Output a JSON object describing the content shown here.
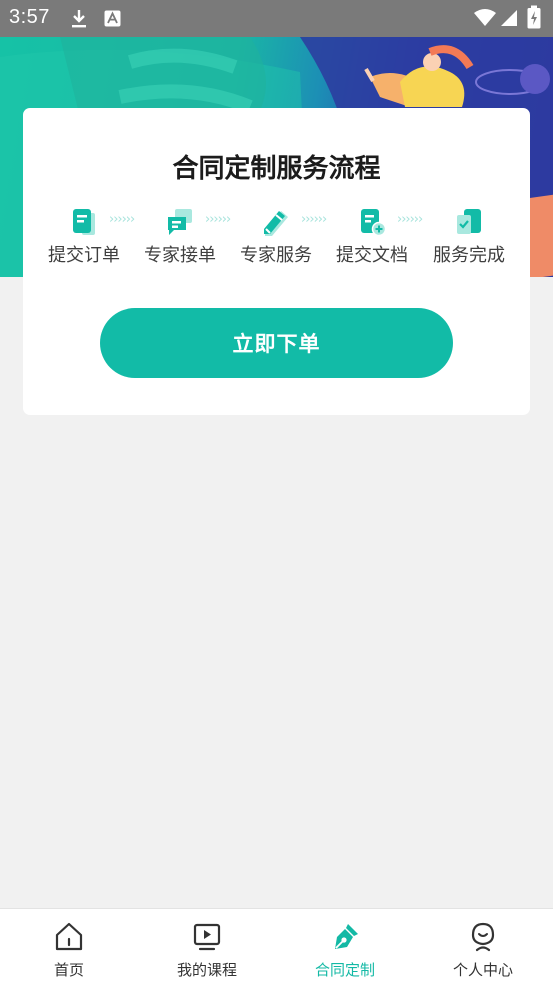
{
  "status_bar": {
    "time": "3:57"
  },
  "card": {
    "title": "合同定制服务流程",
    "steps": [
      {
        "label": "提交订单",
        "icon": "order-doc-icon"
      },
      {
        "label": "专家接单",
        "icon": "chat-bubble-icon"
      },
      {
        "label": "专家服务",
        "icon": "pencil-edit-icon"
      },
      {
        "label": "提交文档",
        "icon": "doc-add-icon"
      },
      {
        "label": "服务完成",
        "icon": "check-doc-icon"
      }
    ],
    "arrow_glyphs": "››››››",
    "order_button": "立即下单"
  },
  "tabs": [
    {
      "label": "首页",
      "icon": "home-icon",
      "active": false
    },
    {
      "label": "我的课程",
      "icon": "play-screen-icon",
      "active": false
    },
    {
      "label": "合同定制",
      "icon": "pen-nib-icon",
      "active": true
    },
    {
      "label": "个人中心",
      "icon": "profile-icon",
      "active": false
    }
  ],
  "colors": {
    "accent": "#12bba7",
    "status_bar": "#7a7a7a",
    "page_bg": "#f1f1f1"
  }
}
